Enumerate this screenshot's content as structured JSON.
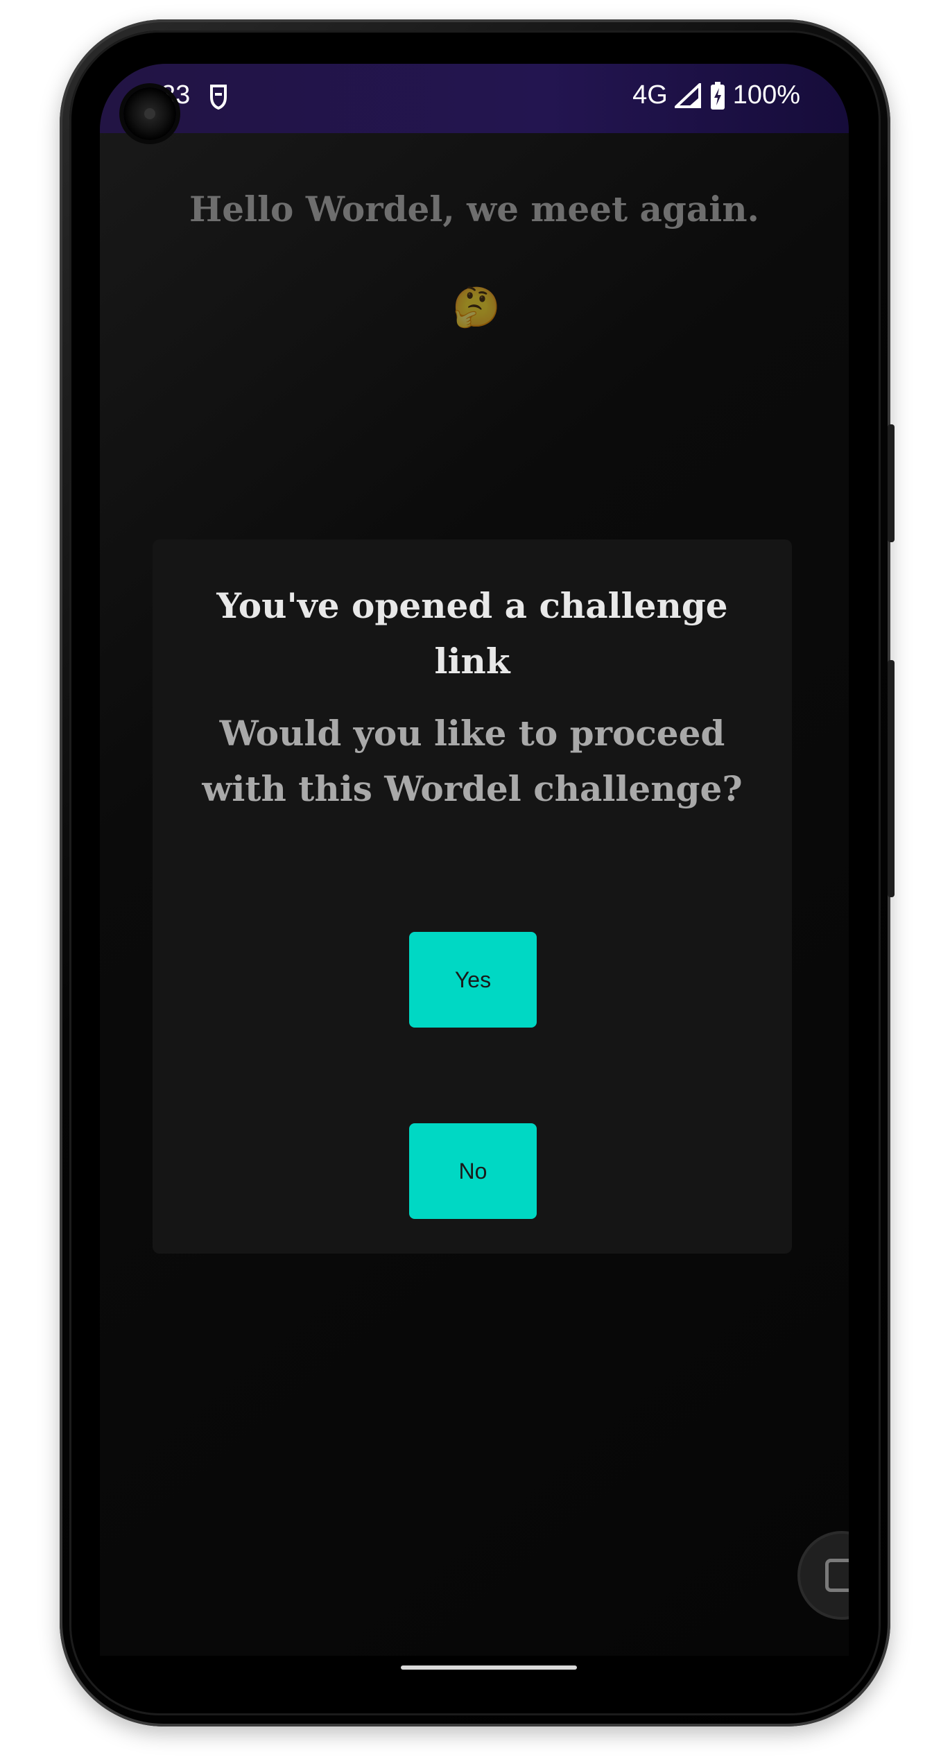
{
  "status_bar": {
    "time": "33",
    "network": "4G",
    "battery": "100%",
    "bg_color": "#221444"
  },
  "main": {
    "greeting": "Hello Wordel, we meet again.",
    "emoji": "🤔"
  },
  "dialog": {
    "title": "You've opened a challenge link",
    "message": "Would you like to proceed with this Wordel challenge?",
    "yes_label": "Yes",
    "no_label": "No",
    "button_color": "#00d8c4"
  },
  "icons": {
    "fab": "edit-square-icon",
    "status_left": "shield-icon",
    "signal": "signal-icon",
    "battery": "battery-charging-icon"
  }
}
